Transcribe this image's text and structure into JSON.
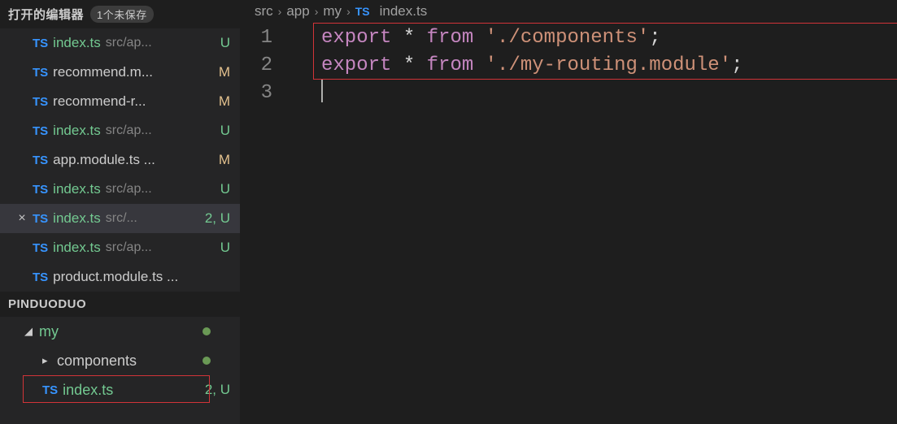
{
  "sidebar": {
    "openEditors": {
      "title": "打开的编辑器",
      "unsaved": "1个未保存",
      "items": [
        {
          "icon": "TS",
          "name": "index.ts",
          "path": "src/ap...",
          "badge": "U",
          "badgeClass": "green",
          "nameClass": "green"
        },
        {
          "icon": "TS",
          "name": "recommend.m...",
          "path": "",
          "badge": "M",
          "badgeClass": "olive"
        },
        {
          "icon": "TS",
          "name": "recommend-r...",
          "path": "",
          "badge": "M",
          "badgeClass": "olive"
        },
        {
          "icon": "TS",
          "name": "index.ts",
          "path": "src/ap...",
          "badge": "U",
          "badgeClass": "green",
          "nameClass": "green"
        },
        {
          "icon": "TS",
          "name": "app.module.ts ...",
          "path": "",
          "badge": "M",
          "badgeClass": "olive"
        },
        {
          "icon": "TS",
          "name": "index.ts",
          "path": "src/ap...",
          "badge": "U",
          "badgeClass": "green",
          "nameClass": "green"
        },
        {
          "icon": "TS",
          "name": "index.ts",
          "path": "src/...",
          "badge": "2, U",
          "badgeClass": "green",
          "nameClass": "green",
          "active": true,
          "close": true
        },
        {
          "icon": "TS",
          "name": "index.ts",
          "path": "src/ap...",
          "badge": "U",
          "badgeClass": "green",
          "nameClass": "green"
        },
        {
          "icon": "TS",
          "name": "product.module.ts ...",
          "path": "",
          "badge": "",
          "badgeClass": ""
        }
      ]
    },
    "explorer": {
      "title": "PINDUODUO",
      "items": [
        {
          "type": "folder",
          "name": "my",
          "indent": 1,
          "expanded": true,
          "nameClass": "green",
          "dot": true
        },
        {
          "type": "folder",
          "name": "components",
          "indent": 2,
          "expanded": false,
          "dot": true
        },
        {
          "type": "file",
          "icon": "TS",
          "name": "index.ts",
          "indent": 2,
          "badge": "2, U",
          "badgeClass": "green",
          "nameClass": "green",
          "highlighted": true
        }
      ]
    }
  },
  "breadcrumb": {
    "parts": [
      "src",
      "app",
      "my"
    ],
    "fileIcon": "TS",
    "fileName": "index.ts"
  },
  "code": {
    "lineNumbers": [
      "1",
      "2",
      "3"
    ],
    "lines": [
      {
        "tokens": [
          {
            "t": "export",
            "c": "kw"
          },
          {
            "t": " * ",
            "c": "op"
          },
          {
            "t": "from",
            "c": "kw"
          },
          {
            "t": " ",
            "c": "op"
          },
          {
            "t": "'./components'",
            "c": "str"
          },
          {
            "t": ";",
            "c": "op"
          }
        ]
      },
      {
        "tokens": [
          {
            "t": "export",
            "c": "kw"
          },
          {
            "t": " * ",
            "c": "op"
          },
          {
            "t": "from",
            "c": "kw"
          },
          {
            "t": " ",
            "c": "op"
          },
          {
            "t": "'./my-routing.module'",
            "c": "str"
          },
          {
            "t": ";",
            "c": "op"
          }
        ]
      },
      {
        "tokens": [],
        "cursor": true
      }
    ]
  }
}
